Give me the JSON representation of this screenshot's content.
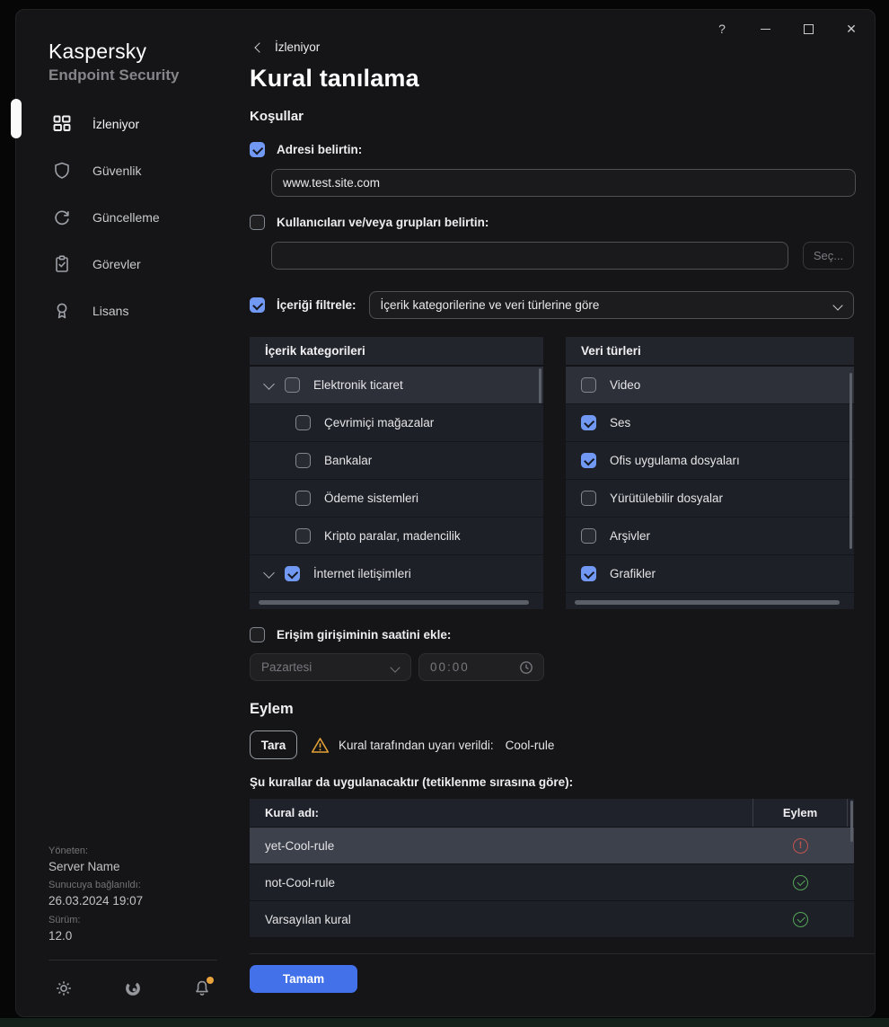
{
  "window_controls": {
    "help": "?",
    "close": "✕"
  },
  "sidebar": {
    "brand": {
      "title": "Kaspersky",
      "subtitle": "Endpoint Security"
    },
    "items": [
      {
        "label": "İzleniyor",
        "icon": "dashboard-icon",
        "active": true
      },
      {
        "label": "Güvenlik",
        "icon": "shield-icon",
        "active": false
      },
      {
        "label": "Güncelleme",
        "icon": "refresh-icon",
        "active": false
      },
      {
        "label": "Görevler",
        "icon": "tasks-icon",
        "active": false
      },
      {
        "label": "Lisans",
        "icon": "license-icon",
        "active": false
      }
    ],
    "management": {
      "managed_label": "Yöneten:",
      "managed_value": "Server Name",
      "connected_label": "Sunucuya bağlanıldı:",
      "connected_value": "26.03.2024 19:07",
      "version_label": "Sürüm:",
      "version_value": "12.0"
    }
  },
  "header": {
    "breadcrumb": "İzleniyor",
    "title": "Kural tanılama"
  },
  "conditions": {
    "section_title": "Koşullar",
    "address": {
      "label": "Adresi belirtin:",
      "checked": true,
      "value": "www.test.site.com"
    },
    "users": {
      "label": "Kullanıcıları ve/veya grupları belirtin:",
      "checked": false,
      "value": "",
      "select_button": "Seç..."
    },
    "content_filter": {
      "label": "İçeriği filtrele:",
      "checked": true,
      "dropdown_value": "İçerik kategorilerine ve veri türlerine göre"
    },
    "categories": {
      "header": "İçerik kategorileri",
      "items": [
        {
          "label": "Elektronik ticaret",
          "checked": false,
          "expanded": true,
          "child": false,
          "selected": true
        },
        {
          "label": "Çevrimiçi mağazalar",
          "checked": false,
          "child": true,
          "selected": false
        },
        {
          "label": "Bankalar",
          "checked": false,
          "child": true,
          "selected": false
        },
        {
          "label": "Ödeme sistemleri",
          "checked": false,
          "child": true,
          "selected": false
        },
        {
          "label": "Kripto paralar, madencilik",
          "checked": false,
          "child": true,
          "selected": false
        },
        {
          "label": "İnternet iletişimleri",
          "checked": true,
          "expanded": true,
          "child": false,
          "selected": false
        }
      ]
    },
    "data_types": {
      "header": "Veri türleri",
      "items": [
        {
          "label": "Video",
          "checked": false,
          "selected": true
        },
        {
          "label": "Ses",
          "checked": true,
          "selected": false
        },
        {
          "label": "Ofis uygulama dosyaları",
          "checked": true,
          "selected": false
        },
        {
          "label": "Yürütülebilir dosyalar",
          "checked": false,
          "selected": false
        },
        {
          "label": "Arşivler",
          "checked": false,
          "selected": false
        },
        {
          "label": "Grafikler",
          "checked": true,
          "selected": false
        }
      ]
    },
    "time": {
      "label": "Erişim girişiminin saatini ekle:",
      "checked": false,
      "day_value": "Pazartesi",
      "time_value": "00:00",
      "disabled": true
    }
  },
  "action": {
    "section_title": "Eylem",
    "scan_button": "Tara",
    "warning_text": "Kural tarafından uyarı verildi:",
    "warning_rule": "Cool-rule",
    "table_caption": "Şu kurallar da uygulanacaktır (tetiklenme sırasına göre):",
    "table": {
      "columns": [
        "Kural adı:",
        "Eylem"
      ],
      "rows": [
        {
          "name": "yet-Cool-rule",
          "status": "error",
          "selected": true
        },
        {
          "name": "not-Cool-rule",
          "status": "ok",
          "selected": false
        },
        {
          "name": "Varsayılan kural",
          "status": "ok",
          "selected": false
        }
      ]
    }
  },
  "footer": {
    "ok_button": "Tamam"
  },
  "colors": {
    "accent_blue": "#4371ea",
    "checkbox_blue": "#7198f2",
    "warning_amber": "#e2a136",
    "error_red": "#c4524e",
    "success_green": "#55a659",
    "window_bg": "#151518",
    "list_bg": "#1d2026",
    "selected_row": "#3d414b"
  }
}
